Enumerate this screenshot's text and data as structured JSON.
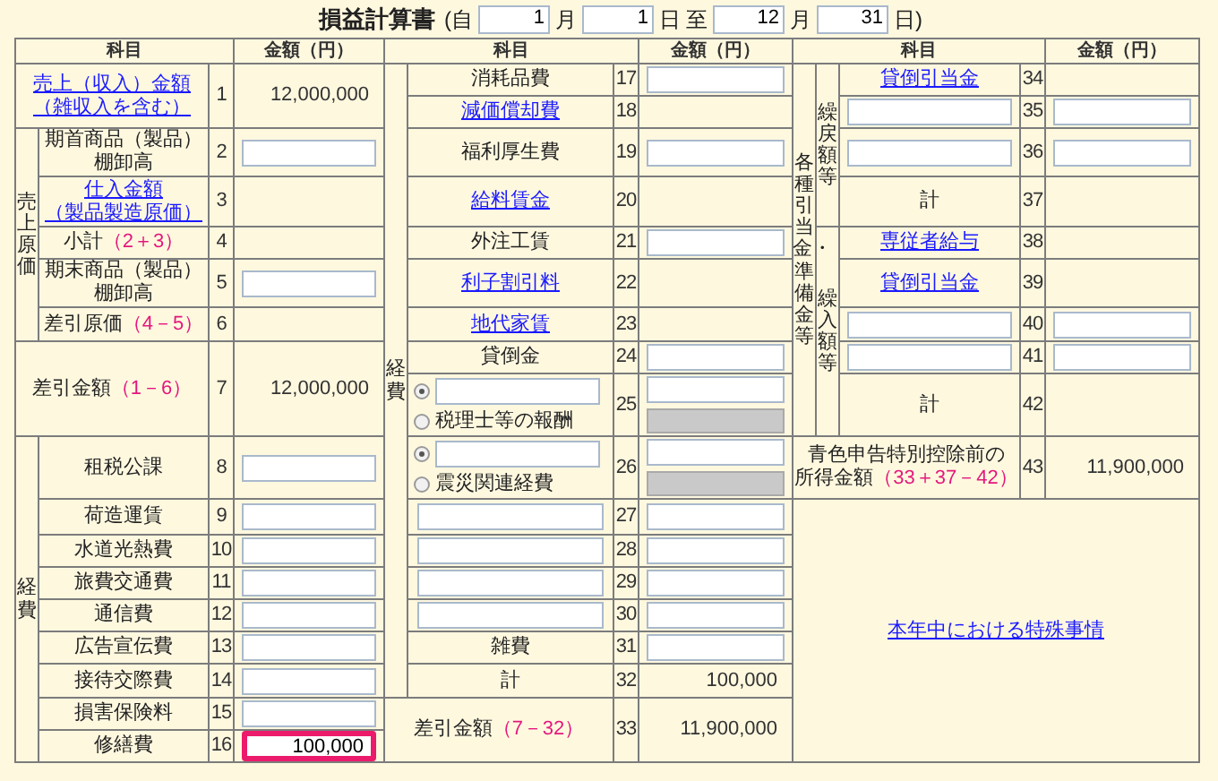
{
  "header": [
    {
      "kind": "title",
      "text": "損益計算書"
    },
    {
      "kind": "text",
      "text": "(自"
    },
    {
      "kind": "input",
      "value": "1"
    },
    {
      "kind": "text",
      "text": "月"
    },
    {
      "kind": "input",
      "value": "1"
    },
    {
      "kind": "text",
      "text": "日"
    },
    {
      "kind": "text",
      "text": "至"
    },
    {
      "kind": "input",
      "value": "12"
    },
    {
      "kind": "text",
      "text": "月"
    },
    {
      "kind": "input",
      "value": "31"
    },
    {
      "kind": "text",
      "text": "日)"
    }
  ],
  "columns": [
    {
      "subject_heading": "科目",
      "amount_heading": "金額（円）",
      "blocks": [
        {
          "kind": "row",
          "no": "1",
          "label": {
            "kind": "link",
            "lines": [
              "売上（収入）金額",
              "（雑収入を含む）"
            ]
          },
          "amount": {
            "kind": "value",
            "text": "12,000,000"
          }
        },
        {
          "kind": "group",
          "title": "売上原価",
          "blocks": [
            {
              "kind": "row",
              "no": "2",
              "label": {
                "kind": "text",
                "lines": [
                  "期首商品（製品）",
                  "棚卸高"
                ]
              },
              "amount": {
                "kind": "field"
              }
            },
            {
              "kind": "row",
              "no": "3",
              "label": {
                "kind": "link",
                "lines": [
                  "仕入金額",
                  "（製品製造原価）"
                ]
              },
              "amount": {
                "kind": "none"
              }
            },
            {
              "kind": "row",
              "no": "4",
              "label": {
                "kind": "text",
                "text": "小計",
                "formula": "（2＋3）"
              },
              "amount": {
                "kind": "none"
              }
            },
            {
              "kind": "row",
              "no": "5",
              "label": {
                "kind": "text",
                "lines": [
                  "期末商品（製品）",
                  "棚卸高"
                ]
              },
              "amount": {
                "kind": "field"
              }
            },
            {
              "kind": "row",
              "no": "6",
              "label": {
                "kind": "text",
                "text": "差引原価",
                "formula": "（4－5）"
              },
              "amount": {
                "kind": "none"
              }
            }
          ]
        },
        {
          "kind": "row",
          "no": "7",
          "label": {
            "kind": "text",
            "text": "差引金額",
            "formula": "（1－6）"
          },
          "amount": {
            "kind": "value",
            "text": "12,000,000"
          }
        },
        {
          "kind": "group",
          "title": "経費",
          "blocks": [
            {
              "kind": "row",
              "no": "8",
              "label": {
                "kind": "text",
                "text": "租税公課"
              },
              "amount": {
                "kind": "field"
              }
            },
            {
              "kind": "row",
              "no": "9",
              "label": {
                "kind": "text",
                "text": "荷造運賃"
              },
              "amount": {
                "kind": "field"
              }
            },
            {
              "kind": "row",
              "no": "10",
              "label": {
                "kind": "text",
                "text": "水道光熱費"
              },
              "amount": {
                "kind": "field"
              }
            },
            {
              "kind": "row",
              "no": "11",
              "label": {
                "kind": "text",
                "text": "旅費交通費"
              },
              "amount": {
                "kind": "field"
              }
            },
            {
              "kind": "row",
              "no": "12",
              "label": {
                "kind": "text",
                "text": "通信費"
              },
              "amount": {
                "kind": "field"
              }
            },
            {
              "kind": "row",
              "no": "13",
              "label": {
                "kind": "text",
                "text": "広告宣伝費"
              },
              "amount": {
                "kind": "field"
              }
            },
            {
              "kind": "row",
              "no": "14",
              "label": {
                "kind": "text",
                "text": "接待交際費"
              },
              "amount": {
                "kind": "field"
              }
            },
            {
              "kind": "row",
              "no": "15",
              "label": {
                "kind": "text",
                "text": "損害保険料"
              },
              "amount": {
                "kind": "field"
              }
            },
            {
              "kind": "row",
              "no": "16",
              "label": {
                "kind": "text",
                "text": "修繕費"
              },
              "amount": {
                "kind": "field",
                "value": "100,000",
                "highlighted": true
              }
            }
          ]
        }
      ]
    },
    {
      "subject_heading": "科目",
      "amount_heading": "金額（円）",
      "blocks": [
        {
          "kind": "group",
          "title": "経費",
          "blocks": [
            {
              "kind": "row",
              "no": "17",
              "label": {
                "kind": "text",
                "text": "消耗品費"
              },
              "amount": {
                "kind": "field"
              }
            },
            {
              "kind": "row",
              "no": "18",
              "label": {
                "kind": "link",
                "text": "減価償却費"
              },
              "amount": {
                "kind": "none"
              }
            },
            {
              "kind": "row",
              "no": "19",
              "label": {
                "kind": "text",
                "text": "福利厚生費"
              },
              "amount": {
                "kind": "field"
              }
            },
            {
              "kind": "row",
              "no": "20",
              "label": {
                "kind": "link",
                "text": "給料賃金"
              },
              "amount": {
                "kind": "none"
              }
            },
            {
              "kind": "row",
              "no": "21",
              "label": {
                "kind": "text",
                "text": "外注工賃"
              },
              "amount": {
                "kind": "field"
              }
            },
            {
              "kind": "row",
              "no": "22",
              "label": {
                "kind": "link",
                "text": "利子割引料"
              },
              "amount": {
                "kind": "none"
              }
            },
            {
              "kind": "row",
              "no": "23",
              "label": {
                "kind": "link",
                "text": "地代家賃"
              },
              "amount": {
                "kind": "none"
              }
            },
            {
              "kind": "row",
              "no": "24",
              "label": {
                "kind": "text",
                "text": "貸倒金"
              },
              "amount": {
                "kind": "field"
              }
            },
            {
              "kind": "row",
              "no": "25",
              "label": {
                "kind": "choice",
                "options": [
                  {
                    "kind": "field",
                    "selected": true
                  },
                  {
                    "kind": "text",
                    "text": "税理士等の報酬",
                    "selected": false
                  }
                ]
              },
              "amount": {
                "kind": "pair"
              }
            },
            {
              "kind": "row",
              "no": "26",
              "label": {
                "kind": "choice",
                "options": [
                  {
                    "kind": "field",
                    "selected": true
                  },
                  {
                    "kind": "text",
                    "text": "震災関連経費",
                    "selected": false
                  }
                ]
              },
              "amount": {
                "kind": "pair"
              }
            },
            {
              "kind": "row",
              "no": "27",
              "label": {
                "kind": "field"
              },
              "amount": {
                "kind": "field"
              }
            },
            {
              "kind": "row",
              "no": "28",
              "label": {
                "kind": "field"
              },
              "amount": {
                "kind": "field"
              }
            },
            {
              "kind": "row",
              "no": "29",
              "label": {
                "kind": "field"
              },
              "amount": {
                "kind": "field"
              }
            },
            {
              "kind": "row",
              "no": "30",
              "label": {
                "kind": "field"
              },
              "amount": {
                "kind": "field"
              }
            },
            {
              "kind": "row",
              "no": "31",
              "label": {
                "kind": "text",
                "text": "雑費"
              },
              "amount": {
                "kind": "field"
              }
            },
            {
              "kind": "row",
              "no": "32",
              "label": {
                "kind": "text",
                "text": "計"
              },
              "amount": {
                "kind": "value",
                "text": "100,000"
              }
            }
          ]
        },
        {
          "kind": "row",
          "no": "33",
          "label": {
            "kind": "text",
            "text": "差引金額",
            "formula": "（7－32）"
          },
          "amount": {
            "kind": "value",
            "text": "11,900,000"
          }
        }
      ]
    },
    {
      "subject_heading": "科目",
      "amount_heading": "金額（円）",
      "blocks": [
        {
          "kind": "group",
          "title": "各種引当金・準備金等",
          "blocks": [
            {
              "kind": "group",
              "title": "繰戻額等",
              "blocks": [
                {
                  "kind": "row",
                  "no": "34",
                  "label": {
                    "kind": "link",
                    "text": "貸倒引当金"
                  },
                  "amount": {
                    "kind": "none"
                  }
                },
                {
                  "kind": "row",
                  "no": "35",
                  "label": {
                    "kind": "field"
                  },
                  "amount": {
                    "kind": "field"
                  }
                },
                {
                  "kind": "row",
                  "no": "36",
                  "label": {
                    "kind": "field"
                  },
                  "amount": {
                    "kind": "field"
                  }
                },
                {
                  "kind": "row",
                  "no": "37",
                  "label": {
                    "kind": "text",
                    "text": "計"
                  },
                  "amount": {
                    "kind": "none"
                  }
                }
              ]
            },
            {
              "kind": "group",
              "title": "繰入額等",
              "blocks": [
                {
                  "kind": "row",
                  "no": "38",
                  "label": {
                    "kind": "link",
                    "text": "専従者給与"
                  },
                  "amount": {
                    "kind": "none"
                  }
                },
                {
                  "kind": "row",
                  "no": "39",
                  "label": {
                    "kind": "link",
                    "text": "貸倒引当金"
                  },
                  "amount": {
                    "kind": "none"
                  }
                },
                {
                  "kind": "row",
                  "no": "40",
                  "label": {
                    "kind": "field"
                  },
                  "amount": {
                    "kind": "field"
                  }
                },
                {
                  "kind": "row",
                  "no": "41",
                  "label": {
                    "kind": "field"
                  },
                  "amount": {
                    "kind": "field"
                  }
                },
                {
                  "kind": "row",
                  "no": "42",
                  "label": {
                    "kind": "text",
                    "text": "計"
                  },
                  "amount": {
                    "kind": "none"
                  }
                }
              ]
            }
          ]
        },
        {
          "kind": "row",
          "no": "43",
          "label": {
            "kind": "text",
            "lines": [
              "青色申告特別控除前の",
              "所得金額"
            ],
            "formula": "（33＋37－42）"
          },
          "amount": {
            "kind": "value",
            "text": "11,900,000"
          }
        },
        {
          "kind": "note",
          "link": "本年中における特殊事情"
        }
      ]
    }
  ]
}
